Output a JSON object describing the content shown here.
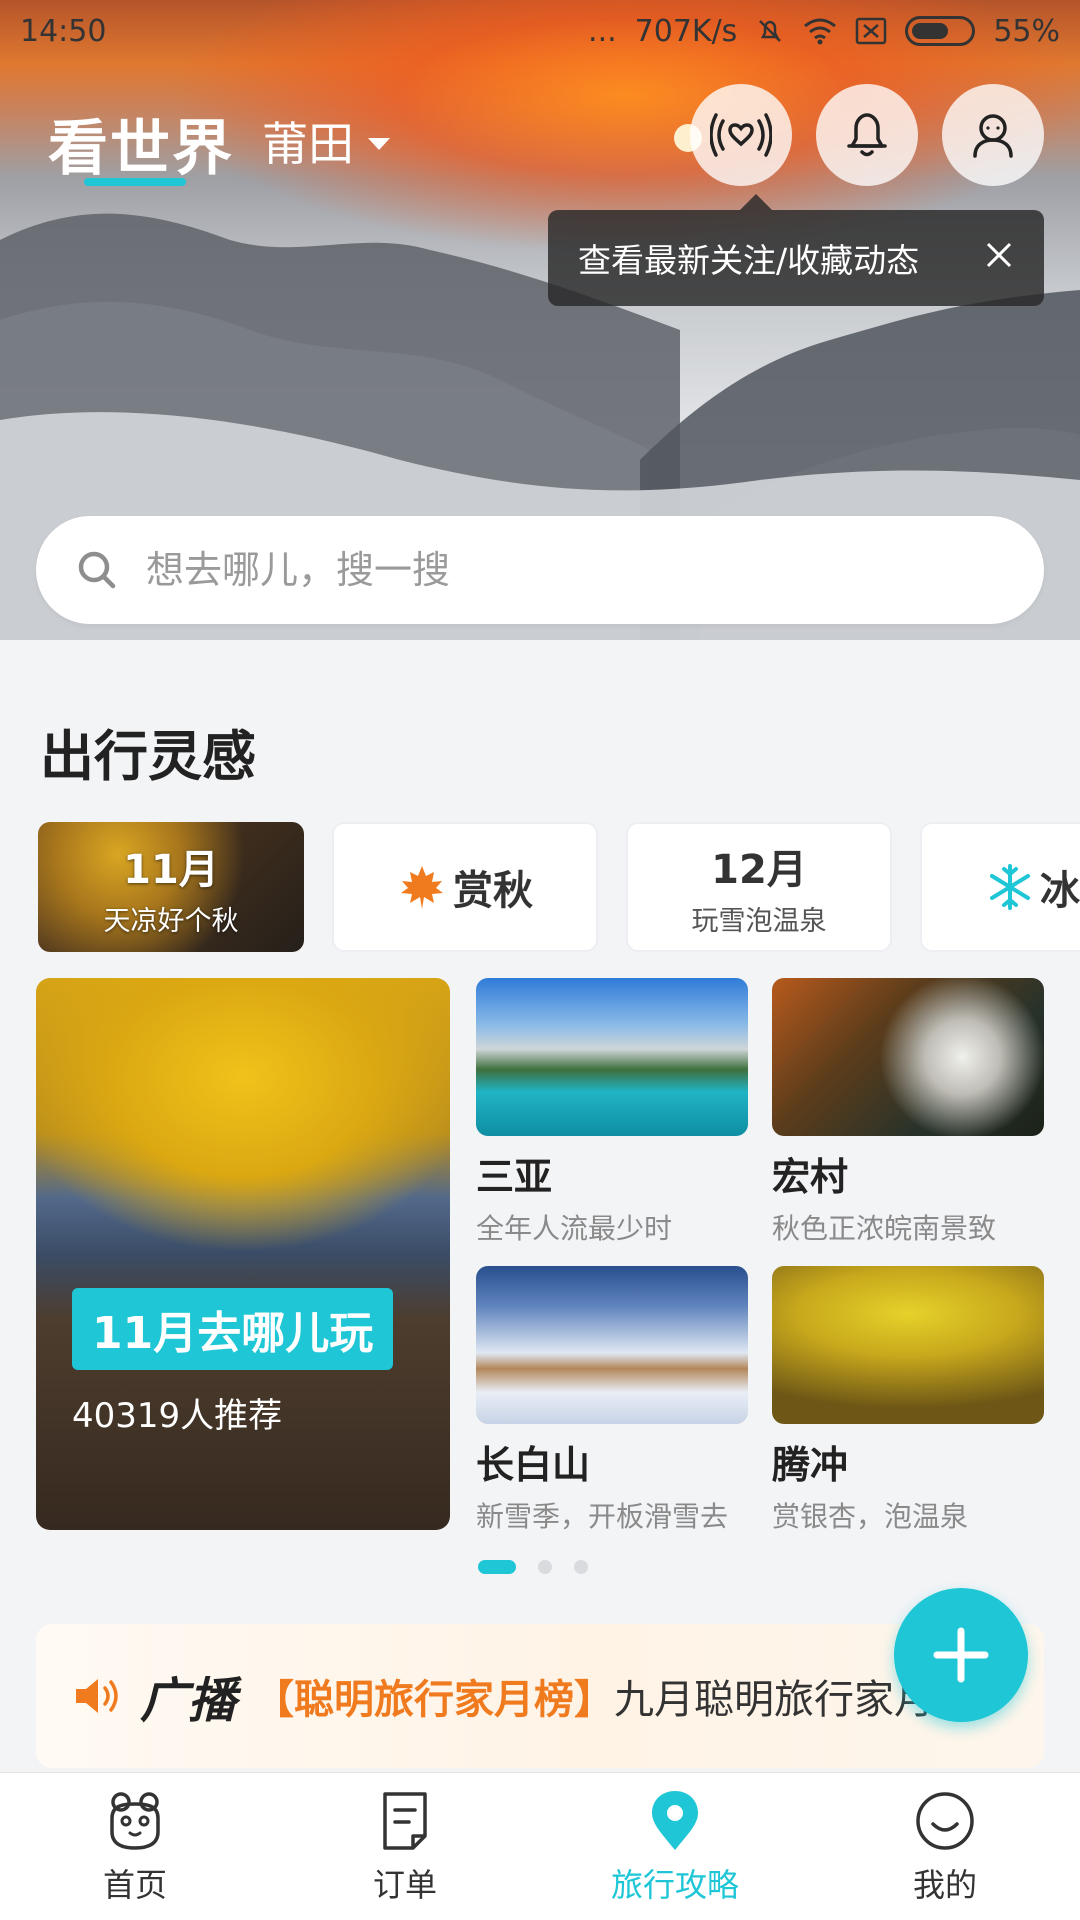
{
  "status_bar": {
    "time": "14:50",
    "dots": "...",
    "speed": "707K/s",
    "battery": "55%"
  },
  "header": {
    "brand": "看世界",
    "city": "莆田",
    "tooltip": "查看最新关注/收藏动态"
  },
  "search": {
    "placeholder": "想去哪儿，搜一搜"
  },
  "inspiration": {
    "title": "出行灵感",
    "chips": [
      {
        "big": "11月",
        "small": "天凉好个秋"
      },
      {
        "big": "赏秋",
        "icon": "maple-leaf-icon"
      },
      {
        "big": "12月",
        "small": "玩雪泡温泉"
      },
      {
        "big": "冰雪",
        "icon": "snowflake-icon"
      }
    ],
    "feature": {
      "title": "11月去哪儿玩",
      "subtitle": "40319人推荐"
    },
    "destinations": [
      {
        "name": "三亚",
        "desc": "全年人流最少时"
      },
      {
        "name": "宏村",
        "desc": "秋色正浓皖南景致"
      },
      {
        "name": "长白山",
        "desc": "新雪季，开板滑雪去"
      },
      {
        "name": "腾冲",
        "desc": "赏银杏，泡温泉"
      }
    ],
    "page_indicator": {
      "total": 3,
      "active": 1
    }
  },
  "broadcast": {
    "title": "广播",
    "tag": "【聪明旅行家月榜】",
    "text": "九月聪明旅行家月"
  },
  "bottom_nav": [
    {
      "label": "首页",
      "icon": "home-mascot-icon",
      "active": false
    },
    {
      "label": "订单",
      "icon": "order-icon",
      "active": false
    },
    {
      "label": "旅行攻略",
      "icon": "location-pin-icon",
      "active": true
    },
    {
      "label": "我的",
      "icon": "smile-face-icon",
      "active": false
    }
  ],
  "colors": {
    "accent": "#1ec6d6",
    "broadcast_tag": "#f07a1e"
  }
}
